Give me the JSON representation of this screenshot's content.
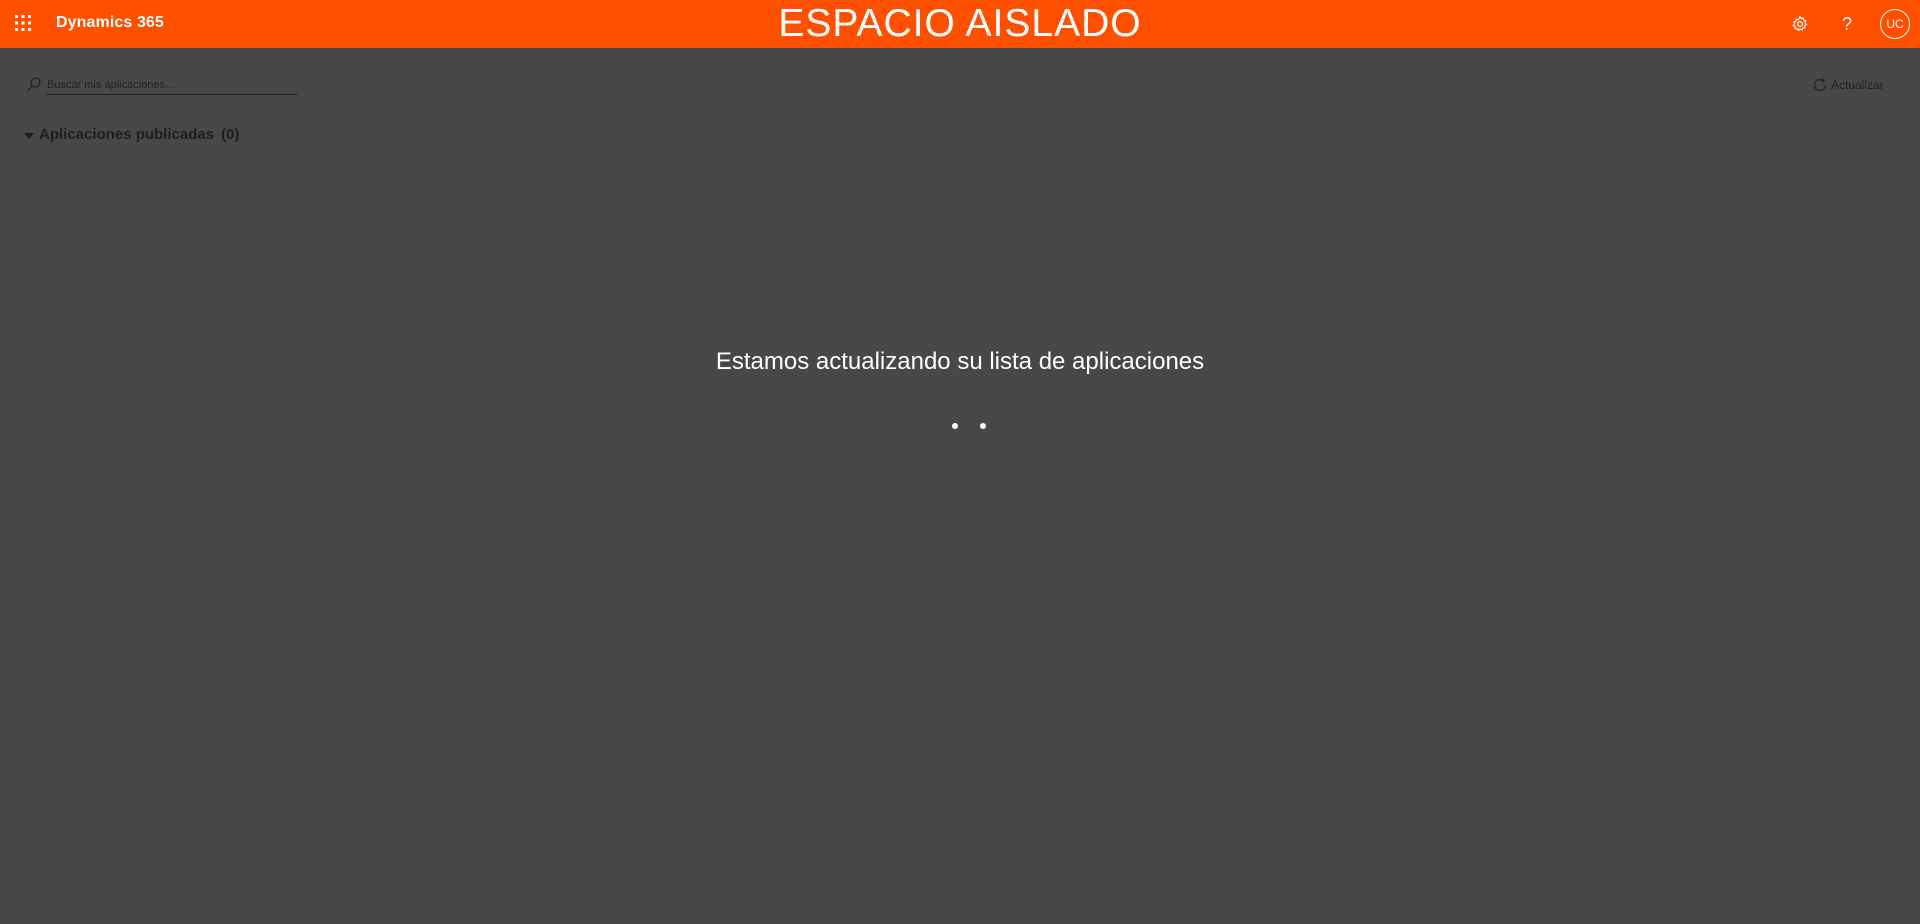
{
  "header": {
    "brand": "Dynamics 365",
    "environment_title": "ESPACIO AISLADO",
    "avatar_initials": "UC",
    "help_label": "?",
    "accent_color": "#ff5000"
  },
  "search": {
    "placeholder": "Buscar mis aplicaciones...",
    "value": ""
  },
  "toolbar": {
    "refresh_label": "Actualizar"
  },
  "section": {
    "title": "Aplicaciones publicadas",
    "count": "(0)"
  },
  "status": {
    "message": "Estamos actualizando su lista de aplicaciones"
  },
  "icons": [
    "app-launcher-icon",
    "gear-icon",
    "help-icon",
    "search-icon",
    "refresh-icon",
    "caret-down-icon"
  ]
}
